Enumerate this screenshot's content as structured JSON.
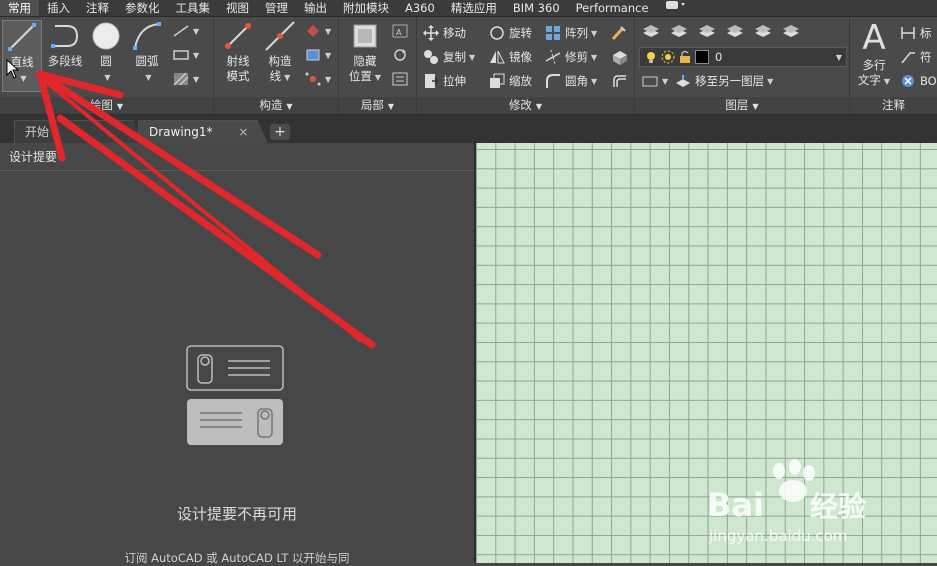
{
  "menu_tabs": [
    "常用",
    "插入",
    "注释",
    "参数化",
    "工具集",
    "视图",
    "管理",
    "输出",
    "附加模块",
    "A360",
    "精选应用",
    "BIM 360",
    "Performance"
  ],
  "ribbon": {
    "draw": {
      "title": "绘图",
      "line": "直线",
      "polyline": "多段线",
      "circle": "圆",
      "arc": "圆弧"
    },
    "construct": {
      "title": "构造",
      "ray_1": "射线",
      "ray_2": "模式",
      "xline_1": "构造",
      "xline_2": "线"
    },
    "local": {
      "title": "局部",
      "hide_1": "隐藏",
      "hide_2": "位置"
    },
    "modify": {
      "title": "修改",
      "move": "移动",
      "rotate": "旋转",
      "array": "阵列",
      "copy": "复制",
      "mirror": "镜像",
      "trim": "修剪",
      "stretch": "拉伸",
      "scale": "缩放",
      "fillet": "圆角"
    },
    "layers": {
      "title": "图层",
      "current_layer": "0",
      "move_layer": "移至另一图层"
    },
    "annotation": {
      "title": "注释",
      "mtext_1": "多行",
      "mtext_2": "文字",
      "dim": "标",
      "sym": "符",
      "bo": "BO"
    }
  },
  "doc_tabs": {
    "start": "开始",
    "drawing": "Drawing1*",
    "close": "×",
    "plus": "+"
  },
  "palette": {
    "title": "设计提要",
    "unavailable": "设计提要不再可用",
    "subtext": "订阅 AutoCAD 或 AutoCAD LT 以开始与同"
  },
  "watermark": {
    "brand_1": "Bai",
    "brand_2": "经验",
    "url": "jingyan.baidu.com"
  },
  "colors": {
    "canvas_bg": "#cfe6cf",
    "grid": "#8aa893",
    "arrow": "#e1272c"
  }
}
